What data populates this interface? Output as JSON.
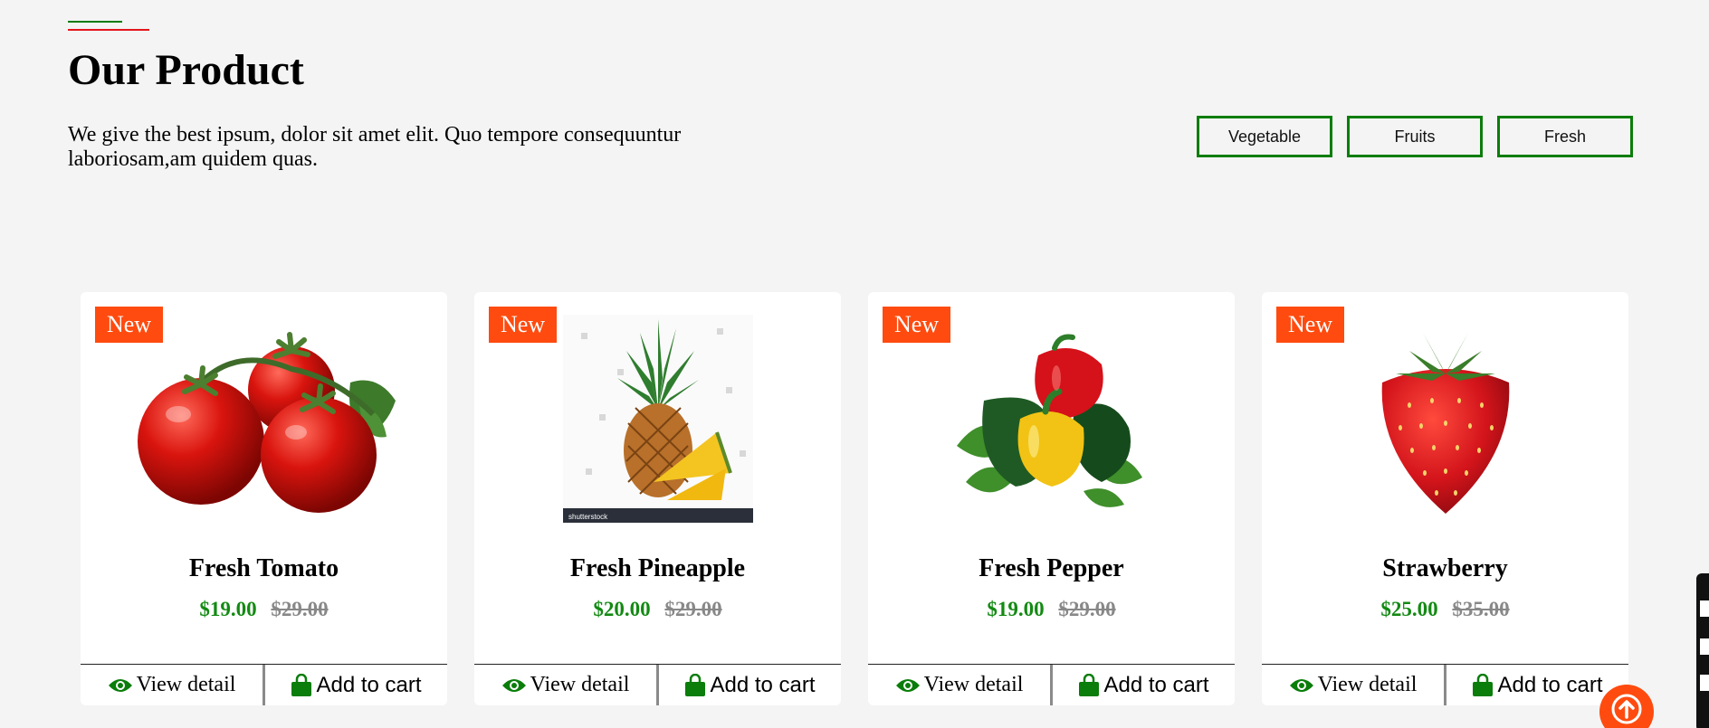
{
  "header": {
    "title": "Our Product",
    "description": "We give the best ipsum, dolor sit amet elit. Quo tempore consequuntur laboriosam,am quidem quas."
  },
  "filters": [
    "Vegetable",
    "Fruits",
    "Fresh"
  ],
  "colors": {
    "accent_green": "#0a7d0a",
    "accent_red": "#e3161b",
    "badge": "#ff4b0f",
    "price_green": "#138a13"
  },
  "products": [
    {
      "badge": "New",
      "name": "Fresh Tomato",
      "price": "$19.00",
      "old_price": "$29.00",
      "view_label": "View detail",
      "cart_label": "Add to cart"
    },
    {
      "badge": "New",
      "name": "Fresh Pineapple",
      "price": "$20.00",
      "old_price": "$29.00",
      "view_label": "View detail",
      "cart_label": "Add to cart",
      "watermark": "shutterstock"
    },
    {
      "badge": "New",
      "name": "Fresh Pepper",
      "price": "$19.00",
      "old_price": "$29.00",
      "view_label": "View detail",
      "cart_label": "Add to cart"
    },
    {
      "badge": "New",
      "name": "Strawberry",
      "price": "$25.00",
      "old_price": "$35.00",
      "view_label": "View detail",
      "cart_label": "Add to cart"
    }
  ],
  "icons": {
    "view": "eye-icon",
    "cart": "shopping-bag-icon",
    "scroll_top": "arrow-up-icon"
  }
}
